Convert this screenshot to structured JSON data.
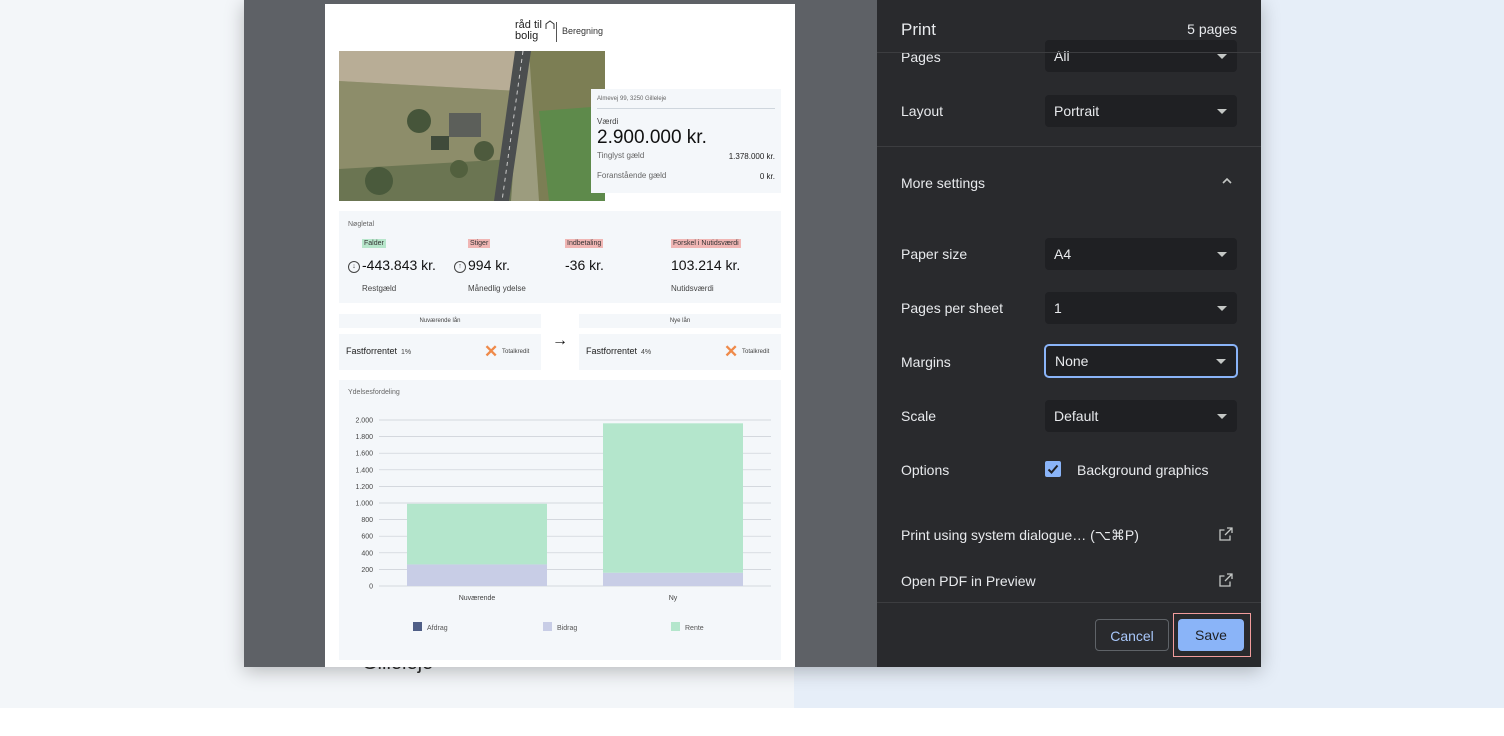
{
  "background": {
    "behind_text": "Gilleleje"
  },
  "print": {
    "title": "Print",
    "pages_count": "5 pages",
    "pages": {
      "label": "Pages",
      "value": "All"
    },
    "layout": {
      "label": "Layout",
      "value": "Portrait"
    },
    "more_settings": {
      "label": "More settings"
    },
    "paper_size": {
      "label": "Paper size",
      "value": "A4"
    },
    "pages_per_sheet": {
      "label": "Pages per sheet",
      "value": "1"
    },
    "margins": {
      "label": "Margins",
      "value": "None"
    },
    "scale": {
      "label": "Scale",
      "value": "Default"
    },
    "options": {
      "label": "Options",
      "background_graphics": "Background graphics",
      "checked": true
    },
    "system_dialog": "Print using system dialogue… (⌥⌘P)",
    "open_pdf": "Open PDF in Preview",
    "cancel": "Cancel",
    "save": "Save"
  },
  "document": {
    "logo": {
      "line1": "råd til",
      "line2": "bolig",
      "section": "Beregning"
    },
    "property": {
      "address": "Almevej 99, 3250 Gilleleje",
      "value_label": "Værdi",
      "value": "2.900.000 kr.",
      "tinglyst_label": "Tinglyst gæld",
      "tinglyst_value": "1.378.000 kr.",
      "foranstaende_label": "Foranstående gæld",
      "foranstaende_value": "0 kr."
    },
    "keyfigures": {
      "title": "Nøgletal",
      "items": [
        {
          "badge": "Falder",
          "badge_color": "#b7e6cb",
          "arrow": "↓",
          "value": "-443.843 kr.",
          "label": "Restgæld"
        },
        {
          "badge": "Stiger",
          "badge_color": "#f0b6b4",
          "arrow": "↑",
          "value": "994 kr.",
          "label": "Månedlig ydelse"
        },
        {
          "badge": "Indbetaling",
          "badge_color": "#f0b6b4",
          "arrow": "",
          "value": "-36 kr.",
          "label": ""
        },
        {
          "badge": "Forskel i Nutidsværdi",
          "badge_color": "#f0b6b4",
          "arrow": "",
          "value": "103.214 kr.",
          "label": "Nutidsværdi"
        }
      ]
    },
    "loans": {
      "current": {
        "header": "Nuværende lån",
        "name": "Fastforrentet",
        "rate": "1%",
        "lender": "Totalkredit"
      },
      "new": {
        "header": "Nye lån",
        "name": "Fastforrentet",
        "rate": "4%",
        "lender": "Totalkredit"
      }
    }
  },
  "chart_data": {
    "type": "bar",
    "stacked": true,
    "title": "Ydelsesfordeling",
    "categories": [
      "Nuværende",
      "Ny"
    ],
    "series": [
      {
        "name": "Afdrag",
        "color": "#4f5e86",
        "values": [
          0,
          0
        ]
      },
      {
        "name": "Bidrag",
        "color": "#c8cde6",
        "values": [
          260,
          160
        ]
      },
      {
        "name": "Rente",
        "color": "#b4e6cc",
        "values": [
          730,
          1800
        ]
      }
    ],
    "ylim": [
      0,
      2000
    ],
    "yticks": [
      0,
      200,
      400,
      600,
      800,
      1000,
      1200,
      1400,
      1600,
      1800,
      2000
    ],
    "ytick_labels": [
      "0",
      "200",
      "400",
      "600",
      "800",
      "1.000",
      "1.200",
      "1.400",
      "1.600",
      "1.800",
      "2.000"
    ],
    "grid": true,
    "legend_position": "bottom"
  }
}
